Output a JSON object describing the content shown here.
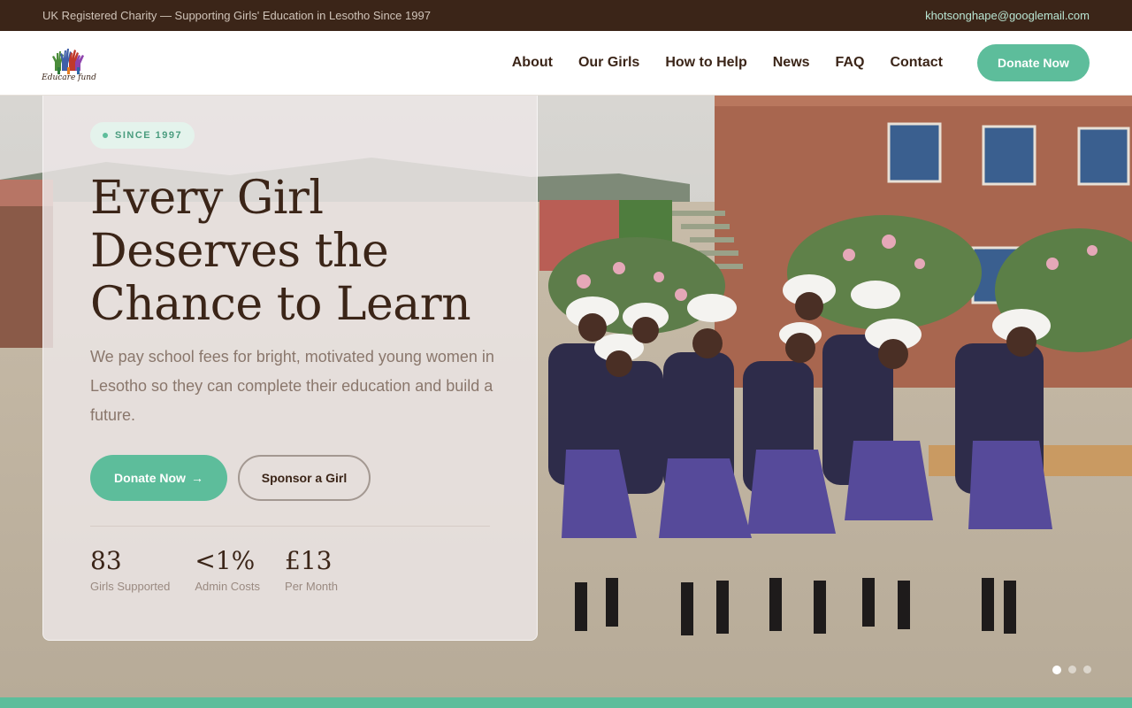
{
  "topbar": {
    "tagline": "UK Registered Charity — Supporting Girls' Education in Lesotho Since 1997",
    "email": "khotsonghape@googlemail.com"
  },
  "nav": {
    "logo_text": "Educare fund",
    "links": [
      "About",
      "Our Girls",
      "How to Help",
      "News",
      "FAQ",
      "Contact"
    ],
    "donate_label": "Donate Now"
  },
  "hero": {
    "badge": "SINCE 1997",
    "headline_lines": [
      "Every Girl",
      "Deserves the",
      "Chance to Learn"
    ],
    "subtitle": "We pay school fees for bright, motivated young women in Lesotho so they can complete their education and build a future.",
    "donate_label": "Donate Now",
    "donate_arrow": "→",
    "sponsor_label": "Sponsor a Girl",
    "stats": [
      {
        "value": "83",
        "label": "Girls Supported"
      },
      {
        "value": "<1%",
        "label": "Admin Costs"
      },
      {
        "value": "£13",
        "label": "Per Month"
      }
    ],
    "slide_count": 3,
    "active_slide": 1
  },
  "colors": {
    "brand_dark": "#3b2518",
    "accent": "#5dbd9b",
    "badge_text": "#4a9c7e",
    "muted_text": "#8a776c",
    "topbar_email": "#b9e6d3"
  }
}
